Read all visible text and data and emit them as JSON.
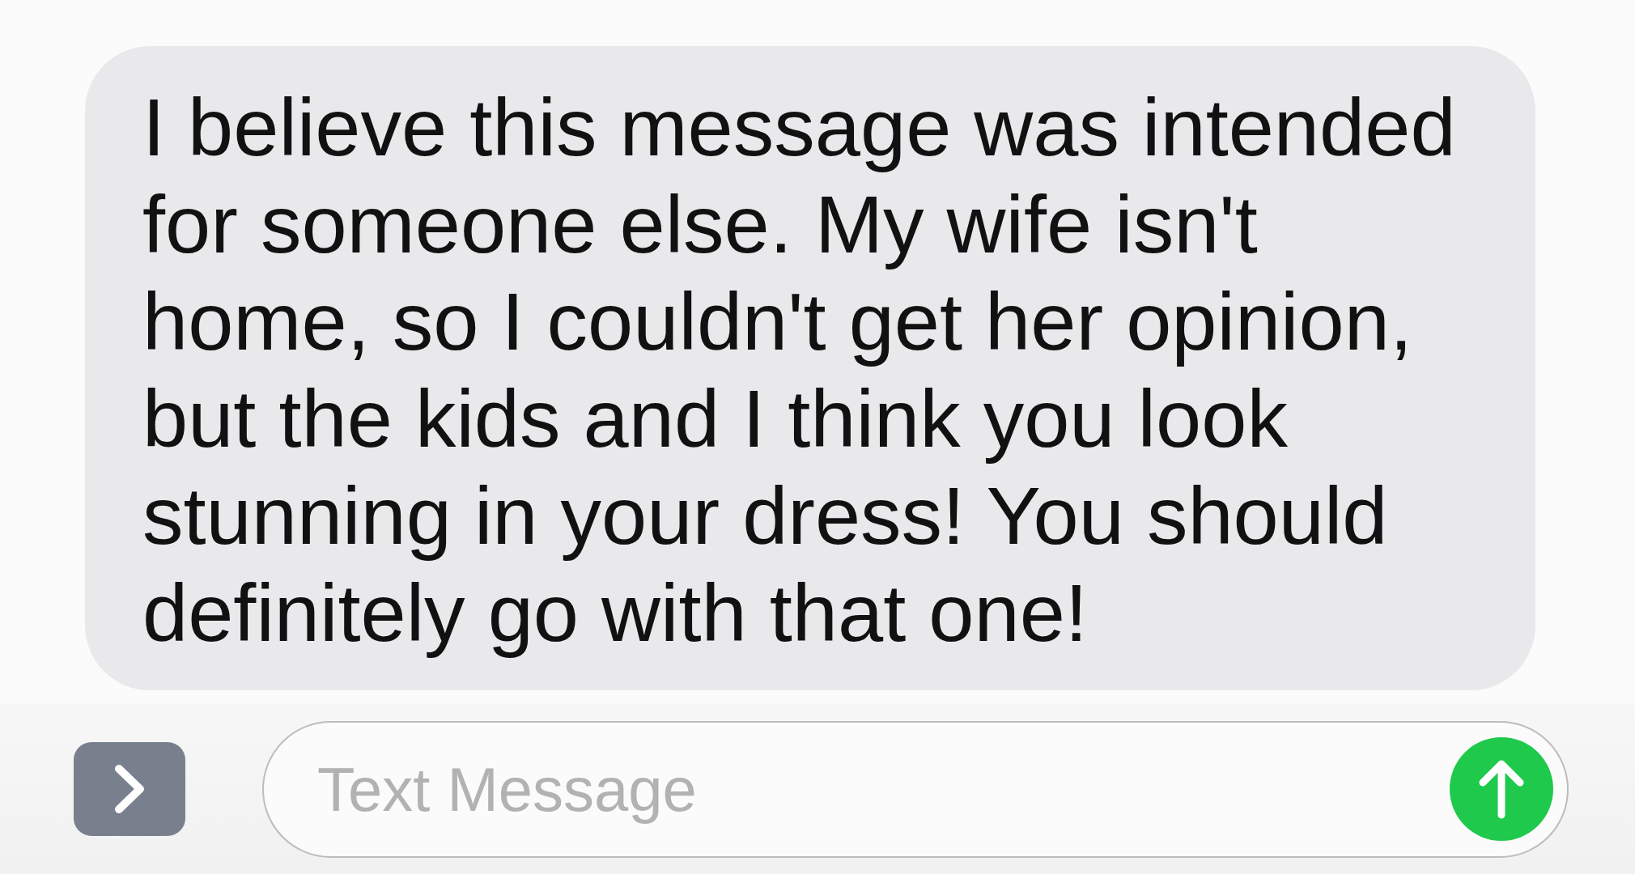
{
  "conversation": {
    "messages": [
      {
        "kind": "received",
        "text": "I believe this message was intended for someone else. My wife isn't home, so I couldn't get her opinion, but the kids and I think you look stunning in your dress! You should definitely go with that one!"
      }
    ]
  },
  "composer": {
    "placeholder": "Text Message"
  }
}
